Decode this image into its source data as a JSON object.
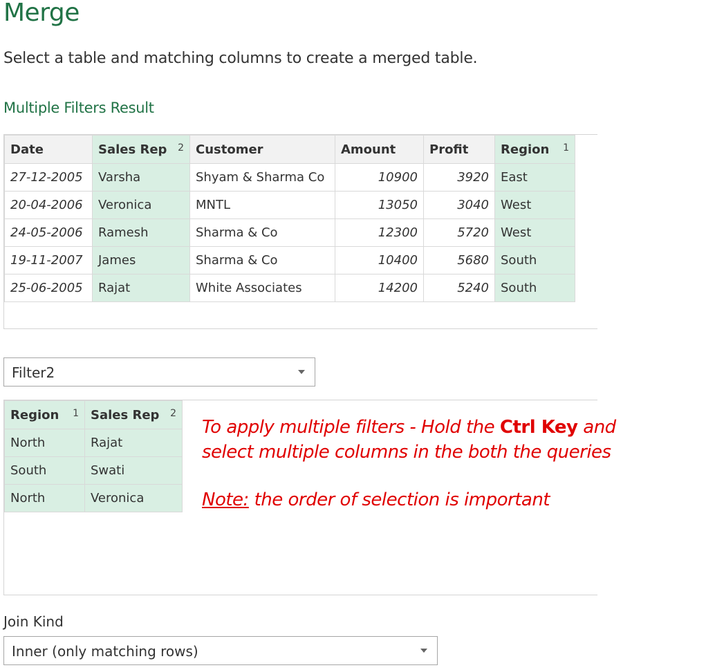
{
  "dialog": {
    "title": "Merge",
    "subtitle": "Select a table and matching columns to create a merged table."
  },
  "primary_table": {
    "name": "Multiple Filters Result",
    "columns": [
      {
        "label": "Date",
        "order": "",
        "selected": false
      },
      {
        "label": "Sales Rep",
        "order": "2",
        "selected": true
      },
      {
        "label": "Customer",
        "order": "",
        "selected": false
      },
      {
        "label": "Amount",
        "order": "",
        "selected": false
      },
      {
        "label": "Profit",
        "order": "",
        "selected": false
      },
      {
        "label": "Region",
        "order": "1",
        "selected": true
      }
    ],
    "rows": [
      [
        "27-12-2005",
        "Varsha",
        "Shyam & Sharma Co",
        "10900",
        "3920",
        "East"
      ],
      [
        "20-04-2006",
        "Veronica",
        "MNTL",
        "13050",
        "3040",
        "West"
      ],
      [
        "24-05-2006",
        "Ramesh",
        "Sharma & Co",
        "12300",
        "5720",
        "West"
      ],
      [
        "19-11-2007",
        "James",
        "Sharma & Co",
        "10400",
        "5680",
        "South"
      ],
      [
        "25-06-2005",
        "Rajat",
        "White Associates",
        "14200",
        "5240",
        "South"
      ]
    ]
  },
  "secondary": {
    "selected_query": "Filter2",
    "columns": [
      {
        "label": "Region",
        "order": "1",
        "selected": true
      },
      {
        "label": "Sales Rep",
        "order": "2",
        "selected": true
      }
    ],
    "rows": [
      [
        "North",
        "Rajat"
      ],
      [
        "South",
        "Swati"
      ],
      [
        "North",
        "Veronica"
      ]
    ]
  },
  "annotation": {
    "line1_a": "To apply multiple filters - Hold the ",
    "line1_bold": "Ctrl Key",
    "line1_b": " and",
    "line2": "select multiple columns in the both the queries",
    "note_label": "Note:",
    "note_text": " the order of selection is important"
  },
  "join": {
    "label": "Join Kind",
    "selected": "Inner (only matching rows)"
  },
  "colors": {
    "accent": "#217346",
    "selected_column": "#d9efe3",
    "annotation": "#e00000"
  },
  "icons": {
    "dropdown_caret": "chevron-down-icon"
  }
}
